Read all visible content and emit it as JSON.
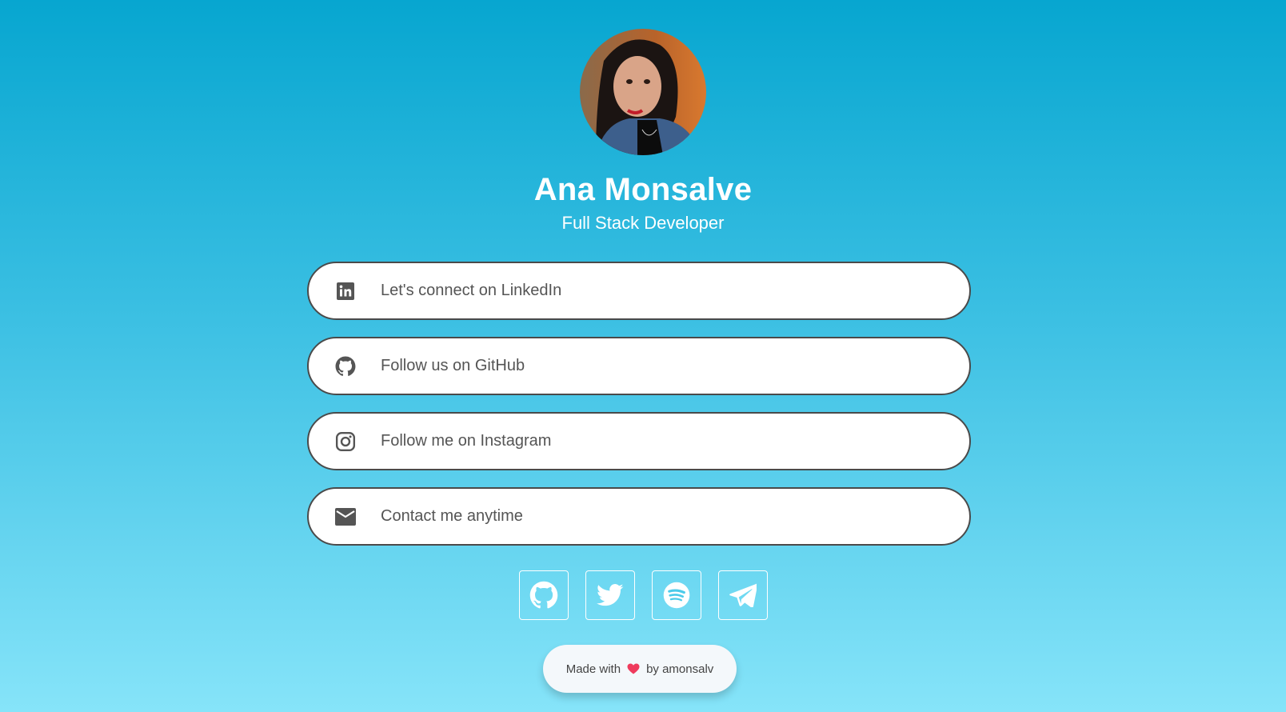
{
  "profile": {
    "name": "Ana Monsalve",
    "title": "Full Stack Developer"
  },
  "links": [
    {
      "icon": "linkedin-icon",
      "label": "Let's connect on LinkedIn"
    },
    {
      "icon": "github-icon",
      "label": "Follow us on GitHub"
    },
    {
      "icon": "instagram-icon",
      "label": "Follow me on Instagram"
    },
    {
      "icon": "mail-icon",
      "label": "Contact me anytime"
    }
  ],
  "socials": [
    {
      "icon": "github-icon"
    },
    {
      "icon": "twitter-icon"
    },
    {
      "icon": "spotify-icon"
    },
    {
      "icon": "telegram-icon"
    }
  ],
  "footer": {
    "prefix": "Made with",
    "icon": "heart-icon",
    "suffix": "by amonsalv"
  },
  "colors": {
    "background_top": "#07a6d0",
    "background_bottom": "#86e4f9",
    "button_border": "#4a4a4a",
    "button_text": "#555555",
    "heart": "#ef3b5d"
  }
}
